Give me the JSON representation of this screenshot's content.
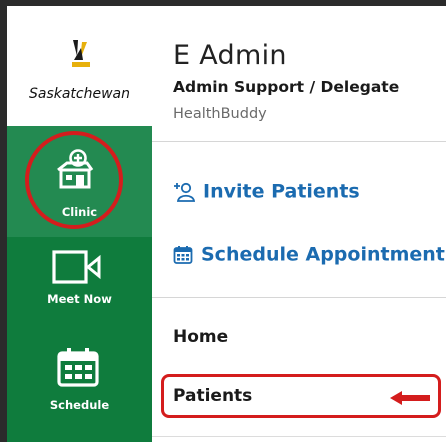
{
  "sidebar": {
    "logo_text": "Saskatchewan",
    "items": [
      {
        "label": "Clinic",
        "icon": "clinic-icon",
        "highlighted": true
      },
      {
        "label": "Meet Now",
        "icon": "video-camera-icon"
      },
      {
        "label": "Schedule",
        "icon": "calendar-icon"
      }
    ]
  },
  "header": {
    "name": "E Admin",
    "role": "Admin Support / Delegate",
    "org": "HealthBuddy"
  },
  "actions": {
    "invite_label": "Invite Patients",
    "schedule_label": "Schedule Appointment"
  },
  "menu": {
    "home_label": "Home",
    "patients_label": "Patients"
  },
  "colors": {
    "nav_green": "#0f7c3d",
    "nav_active_green": "#238a51",
    "link_blue": "#1b6bb0",
    "annotation_red": "#d41d1d"
  }
}
